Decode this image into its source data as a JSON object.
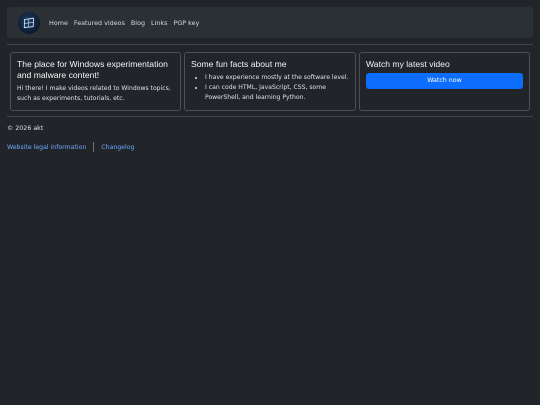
{
  "nav": {
    "logo": "windows-logo-icon",
    "links": [
      "Home",
      "Featured videos",
      "Blog",
      "Links",
      "PGP key"
    ]
  },
  "cards": {
    "intro": {
      "title": "The place for Windows experimentation and malware content!",
      "text": "Hi there! I make videos related to Windows topics, such as experiments, tutorials, etc."
    },
    "facts": {
      "title": "Some fun facts about me",
      "items": [
        "I have experience mostly at the software level.",
        "I can code HTML, JavaScript, CSS, some PowerShell, and learning Python."
      ]
    },
    "video": {
      "title": "Watch my latest video",
      "button": "Watch now"
    }
  },
  "footer": {
    "copyright": "© 2026 akt",
    "links": [
      "Website legal information",
      "Changelog"
    ]
  },
  "colors": {
    "background": "#212529",
    "navbar": "#2b3035",
    "accent": "#0d6efd",
    "link": "#6ea8fe"
  }
}
